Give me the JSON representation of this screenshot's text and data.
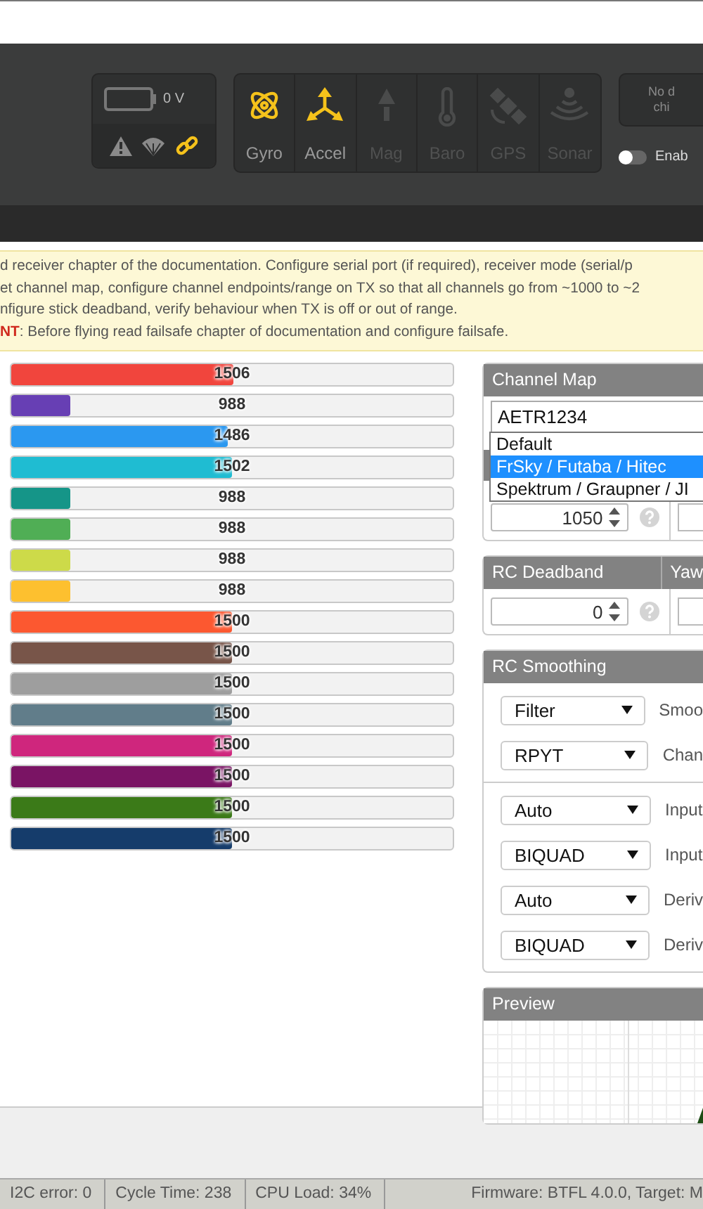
{
  "header": {
    "battery": {
      "voltage": "0 V"
    },
    "status_icons": [
      {
        "kind": "warning",
        "active": false
      },
      {
        "kind": "parachute",
        "active": false
      },
      {
        "kind": "link",
        "active": true
      }
    ],
    "sensors": [
      {
        "kind": "gyro",
        "label": "Gyro",
        "active": true
      },
      {
        "kind": "accel",
        "label": "Accel",
        "active": true
      },
      {
        "kind": "mag",
        "label": "Mag",
        "active": false
      },
      {
        "kind": "baro",
        "label": "Baro",
        "active": false
      },
      {
        "kind": "gps",
        "label": "GPS",
        "active": false
      },
      {
        "kind": "sonar",
        "label": "Sonar",
        "active": false
      }
    ],
    "dataflash": {
      "lines": [
        "No d",
        "chi"
      ]
    },
    "toggle": {
      "label": "Enab",
      "on": false
    }
  },
  "note": {
    "lines": [
      "d receiver chapter of the documentation. Configure serial port (if required), receiver mode (serial/p",
      "et channel map, configure channel endpoints/range on TX so that all channels go from ~1000 to ~2",
      "nfigure stick deadband, verify behaviour when TX is off or out of range.",
      "**NT**: Before flying read failsafe chapter of documentation and configure failsafe."
    ]
  },
  "channels": [
    {
      "value": "1506",
      "level": 0.504,
      "color": "#f1453d"
    },
    {
      "value": "988",
      "level": 0.134,
      "color": "#673fb4"
    },
    {
      "value": "1486",
      "level": 0.49,
      "color": "#2b98f0"
    },
    {
      "value": "1502",
      "level": 0.501,
      "color": "#1fbcd2"
    },
    {
      "value": "988",
      "level": 0.134,
      "color": "#159588"
    },
    {
      "value": "988",
      "level": 0.134,
      "color": "#50ae55"
    },
    {
      "value": "988",
      "level": 0.134,
      "color": "#cdda49"
    },
    {
      "value": "988",
      "level": 0.134,
      "color": "#fdc02f"
    },
    {
      "value": "1500",
      "level": 0.5,
      "color": "#fc5830"
    },
    {
      "value": "1500",
      "level": 0.5,
      "color": "#785549"
    },
    {
      "value": "1500",
      "level": 0.5,
      "color": "#9e9e9e"
    },
    {
      "value": "1500",
      "level": 0.5,
      "color": "#617d8a"
    },
    {
      "value": "1500",
      "level": 0.5,
      "color": "#cf267d"
    },
    {
      "value": "1500",
      "level": 0.5,
      "color": "#7a1464"
    },
    {
      "value": "1500",
      "level": 0.5,
      "color": "#3b7a18"
    },
    {
      "value": "1500",
      "level": 0.5,
      "color": "#153c6b"
    }
  ],
  "channel_map": {
    "title": "Channel Map",
    "value": "AETR1234",
    "options": [
      {
        "label": "Default",
        "selected": false
      },
      {
        "label": "FrSky / Futaba / Hitec",
        "selected": true
      },
      {
        "label": "Spektrum / Graupner / JI",
        "selected": false
      }
    ],
    "input": "1050"
  },
  "rc_deadband": {
    "headers": [
      "RC Deadband",
      "Yaw"
    ],
    "input": "0"
  },
  "rc_smoothing": {
    "title": "RC Smoothing",
    "groups": [
      [
        {
          "value": "Filter",
          "label": "Smoo"
        },
        {
          "value": "RPYT",
          "label": "Chan"
        }
      ],
      [
        {
          "value": "Auto",
          "label": "Input"
        },
        {
          "value": "BIQUAD",
          "label": "Input"
        },
        {
          "value": "Auto",
          "label": "Deriv"
        },
        {
          "value": "BIQUAD",
          "label": "Deriv"
        }
      ]
    ]
  },
  "preview": {
    "title": "Preview"
  },
  "status_bar": [
    "I2C error: 0",
    "Cycle Time: 238",
    "CPU Load: 34%",
    "Firmware: BTFL 4.0.0, Target: M"
  ]
}
